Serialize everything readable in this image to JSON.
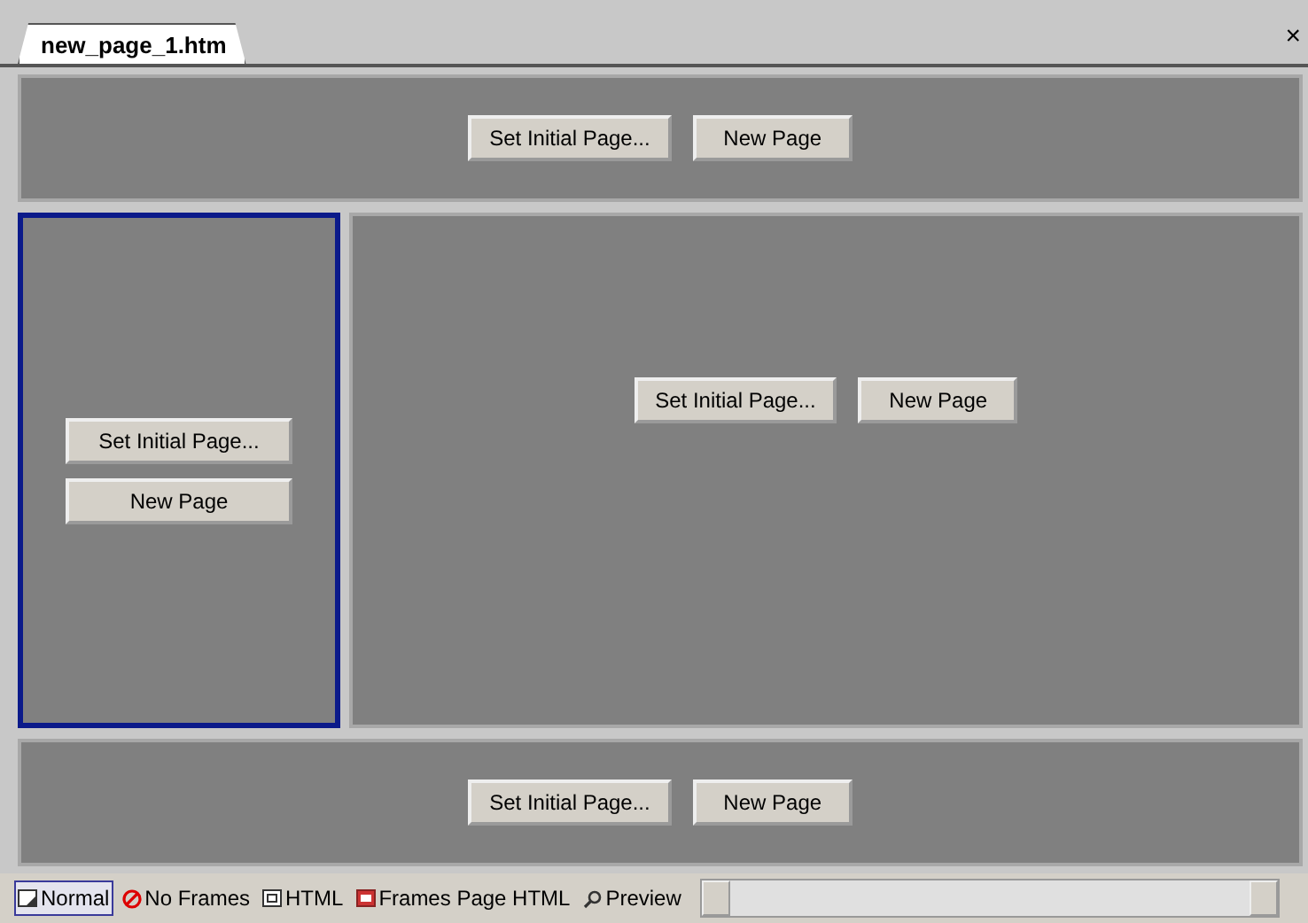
{
  "document_tab": {
    "label": "new_page_1.htm",
    "close": "×"
  },
  "frames": {
    "top": {
      "selected": false,
      "buttons": [
        "Set Initial Page...",
        "New Page"
      ]
    },
    "left": {
      "selected": true,
      "buttons": [
        "Set Initial Page...",
        "New Page"
      ]
    },
    "right": {
      "selected": false,
      "buttons": [
        "Set Initial Page...",
        "New Page"
      ]
    },
    "bottom": {
      "selected": false,
      "buttons": [
        "Set Initial Page...",
        "New Page"
      ]
    }
  },
  "view_tabs": [
    {
      "kind": "normal",
      "label": "Normal",
      "selected": true
    },
    {
      "kind": "noframes",
      "label": "No Frames",
      "selected": false
    },
    {
      "kind": "html",
      "label": "HTML",
      "selected": false
    },
    {
      "kind": "frameshtml",
      "label": "Frames Page HTML",
      "selected": false
    },
    {
      "kind": "preview",
      "label": "Preview",
      "selected": false
    }
  ]
}
